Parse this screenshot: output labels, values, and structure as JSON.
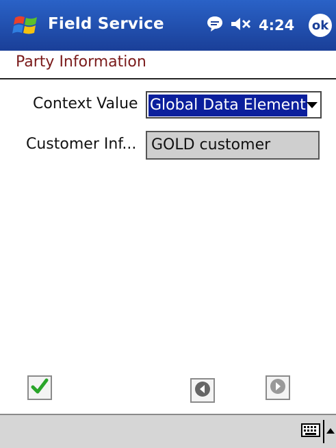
{
  "titlebar": {
    "app_title": "Field Service",
    "time": "4:24",
    "ok_label": "ok",
    "icons": [
      "windows-start-icon",
      "message-icon",
      "speaker-muted-icon"
    ]
  },
  "page": {
    "title": "Party Information"
  },
  "form": {
    "context_value_label": "Context Value",
    "context_value_selected": "Global Data Element",
    "customer_info_label": "Customer Inf...",
    "customer_info_value": "GOLD customer"
  },
  "toolbar": {
    "icons": [
      "checkmark-icon",
      "back-arrow-icon",
      "forward-arrow-icon"
    ]
  },
  "bottombar": {
    "icons": [
      "keyboard-icon",
      "input-panel-arrow-icon"
    ]
  }
}
